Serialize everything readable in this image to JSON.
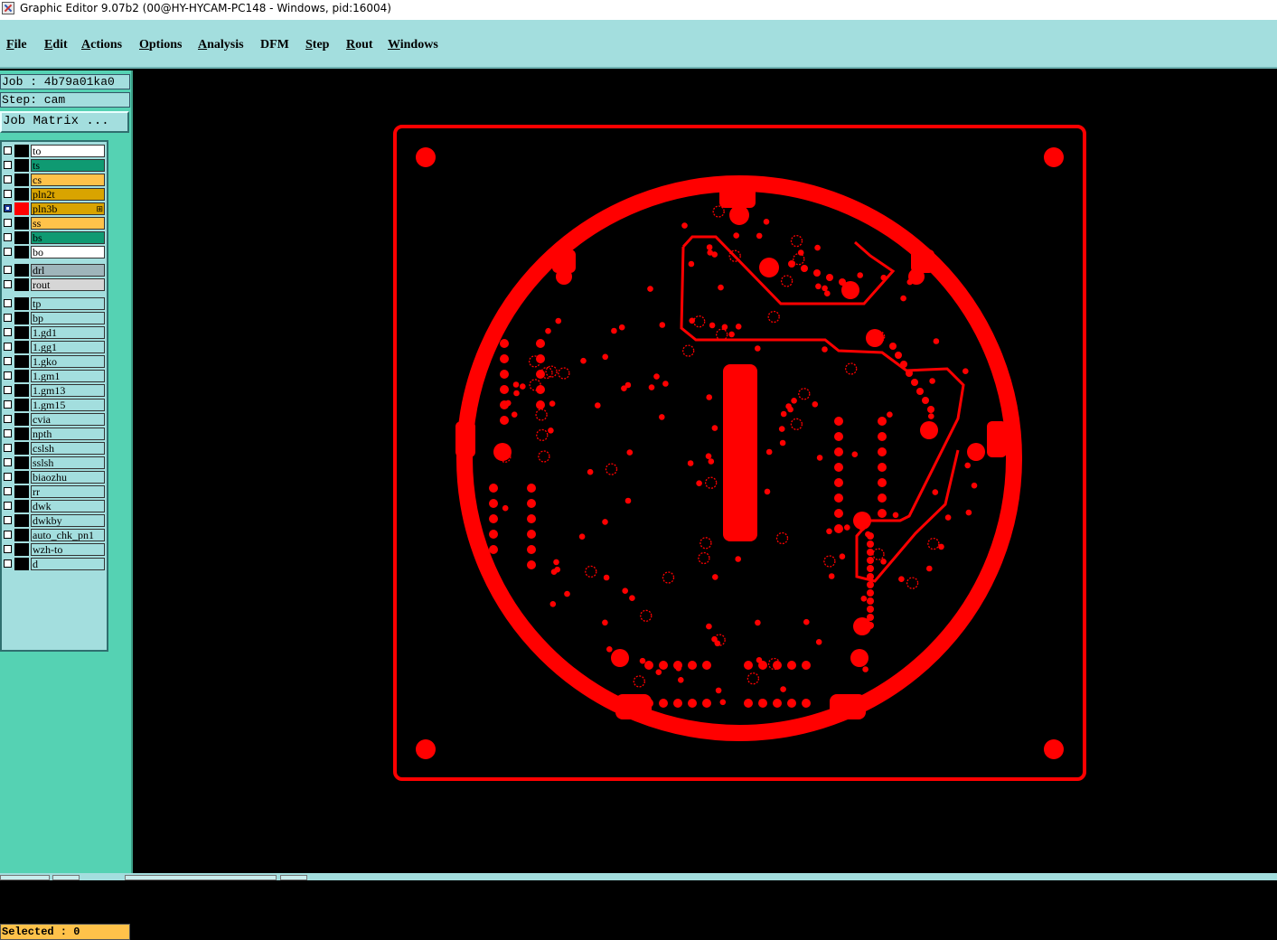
{
  "window": {
    "title": "Graphic Editor 9.07b2 (00@HY-HYCAM-PC148 - Windows, pid:16004)"
  },
  "menu": [
    {
      "label": "File",
      "ul": "F",
      "rest": "ile"
    },
    {
      "label": "Edit",
      "ul": "E",
      "rest": "dit"
    },
    {
      "label": "Actions",
      "ul": "A",
      "rest": "ctions"
    },
    {
      "label": "Options",
      "ul": "O",
      "rest": "ptions"
    },
    {
      "label": "Analysis",
      "ul": "A",
      "rest": "nalysis"
    },
    {
      "label": "DFM",
      "ul": "",
      "rest": "DFM"
    },
    {
      "label": "Step",
      "ul": "S",
      "rest": "tep"
    },
    {
      "label": "Rout",
      "ul": "R",
      "rest": "out"
    },
    {
      "label": "Windows",
      "ul": "W",
      "rest": "indows"
    }
  ],
  "job": {
    "label": "Job : 4b79a01ka0",
    "step": "Step: cam",
    "matrix_button": "Job Matrix ..."
  },
  "layers": [
    {
      "name": "to",
      "color": "#ffffff",
      "selected": false
    },
    {
      "name": "ts",
      "color": "#0f9a72",
      "selected": false
    },
    {
      "name": "cs",
      "color": "#ffc24a",
      "selected": false
    },
    {
      "name": "pln2t",
      "color": "#d9a400",
      "selected": false
    },
    {
      "name": "pln3b",
      "color": "#d9a400",
      "selected": true
    },
    {
      "name": "ss",
      "color": "#ffc24a",
      "selected": false
    },
    {
      "name": "bs",
      "color": "#0f9a72",
      "selected": false
    },
    {
      "name": "bo",
      "color": "#ffffff",
      "selected": false
    },
    {
      "name": "drl",
      "color": "#9fb5bb",
      "selected": false
    },
    {
      "name": "rout",
      "color": "#d6d6d6",
      "selected": false
    },
    {
      "name": "tp",
      "color": "#a3dede",
      "selected": false
    },
    {
      "name": "bp",
      "color": "#a3dede",
      "selected": false
    },
    {
      "name": "1.gd1",
      "color": "#a3dede",
      "selected": false
    },
    {
      "name": "1.gg1",
      "color": "#a3dede",
      "selected": false
    },
    {
      "name": "1.gko",
      "color": "#a3dede",
      "selected": false
    },
    {
      "name": "1.gm1",
      "color": "#a3dede",
      "selected": false
    },
    {
      "name": "1.gm13",
      "color": "#a3dede",
      "selected": false
    },
    {
      "name": "1.gm15",
      "color": "#a3dede",
      "selected": false
    },
    {
      "name": "cvia",
      "color": "#a3dede",
      "selected": false
    },
    {
      "name": "npth",
      "color": "#a3dede",
      "selected": false
    },
    {
      "name": "cslsh",
      "color": "#a3dede",
      "selected": false
    },
    {
      "name": "sslsh",
      "color": "#a3dede",
      "selected": false
    },
    {
      "name": "biaozhu",
      "color": "#a3dede",
      "selected": false
    },
    {
      "name": "rr",
      "color": "#a3dede",
      "selected": false
    },
    {
      "name": "dwk",
      "color": "#a3dede",
      "selected": false
    },
    {
      "name": "dwkby",
      "color": "#a3dede",
      "selected": false
    },
    {
      "name": "auto_chk_pn1",
      "color": "#a3dede",
      "selected": false
    },
    {
      "name": "wzh-to",
      "color": "#a3dede",
      "selected": false
    },
    {
      "name": "d",
      "color": "#a3dede",
      "selected": false
    }
  ],
  "status": {
    "selected": "Selected : 0"
  },
  "colors": {
    "feature": "#ff0000",
    "background": "#000000",
    "panel": "#55d2b3",
    "menubar": "#a3dede"
  },
  "icons": {
    "app": "graphic-editor-app-icon"
  }
}
